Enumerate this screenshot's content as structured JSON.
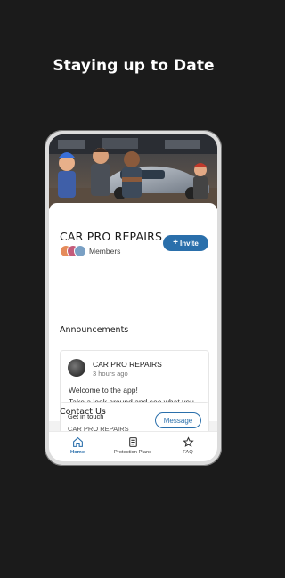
{
  "headline": "Staying up to Date",
  "business": {
    "name": "CAR PRO REPAIRS",
    "members_label": "Members",
    "invite_label": "Invite"
  },
  "announcements": {
    "title": "Announcements",
    "post": {
      "author": "CAR PRO REPAIRS",
      "time": "3 hours ago",
      "body_line1": "Welcome to the app!",
      "body_line2": "Take a look around and see what you can do!"
    }
  },
  "contact": {
    "title": "Contact Us",
    "heading": "Get in touch",
    "name": "CAR PRO REPAIRS",
    "button": "Message"
  },
  "nav": {
    "items": [
      {
        "label": "Home",
        "icon": "home-icon",
        "active": true
      },
      {
        "label": "Protection Plans",
        "icon": "document-icon",
        "active": false
      },
      {
        "label": "FAQ",
        "icon": "star-icon",
        "active": false
      }
    ]
  },
  "colors": {
    "accent": "#2a6fab",
    "background": "#1b1b1b"
  }
}
